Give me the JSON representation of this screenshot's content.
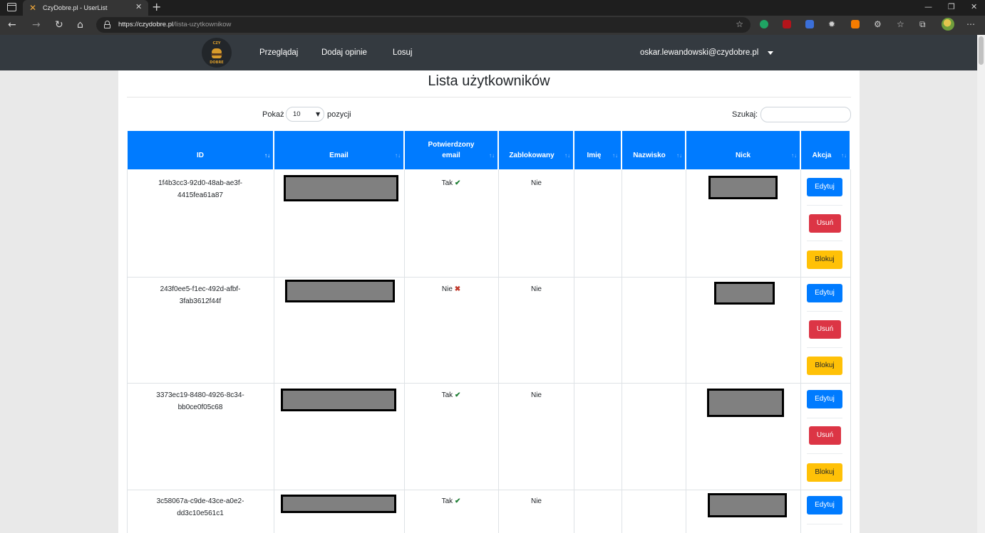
{
  "browser": {
    "tab_title": "CzyDobre.pl - UserList",
    "url_host": "https://czydobre.pl",
    "url_path": "/lista-uzytkownikow"
  },
  "navbar": {
    "logo_top": "CZY",
    "logo_bottom": "DOBRE",
    "links": [
      "Przeglądaj",
      "Dodaj opinie",
      "Losuj"
    ],
    "user": "oskar.lewandowski@czydobre.pl"
  },
  "page": {
    "title": "Lista użytkowników",
    "show_label": "Pokaż",
    "show_value": "10",
    "show_after": "pozycji",
    "search_label": "Szukaj:"
  },
  "table": {
    "headers": {
      "id": "ID",
      "email": "Email",
      "confirmed_line1": "Potwierdzony",
      "confirmed_line2": "email",
      "blocked": "Zablokowany",
      "first_name": "Imię",
      "last_name": "Nazwisko",
      "nick": "Nick",
      "action": "Akcja"
    },
    "rows": [
      {
        "id_line1": "1f4b3cc3-92d0-48ab-ae3f-",
        "id_line2": "4415fea61a87",
        "confirmed": "Tak",
        "confirmed_mark": "✔",
        "blocked": "Nie"
      },
      {
        "id_line1": "243f0ee5-f1ec-492d-afbf-",
        "id_line2": "3fab3612f44f",
        "confirmed": "Nie",
        "confirmed_mark": "✖",
        "blocked": "Nie"
      },
      {
        "id_line1": "3373ec19-8480-4926-8c34-",
        "id_line2": "bb0ce0f05c68",
        "confirmed": "Tak",
        "confirmed_mark": "✔",
        "blocked": "Nie"
      },
      {
        "id_line1": "3c58067a-c9de-43ce-a0e2-",
        "id_line2": "dd3c10e561c1",
        "confirmed": "Tak",
        "confirmed_mark": "✔",
        "blocked": "Nie"
      }
    ],
    "actions": {
      "edit": "Edytuj",
      "delete": "Usuń",
      "block": "Blokuj"
    }
  }
}
